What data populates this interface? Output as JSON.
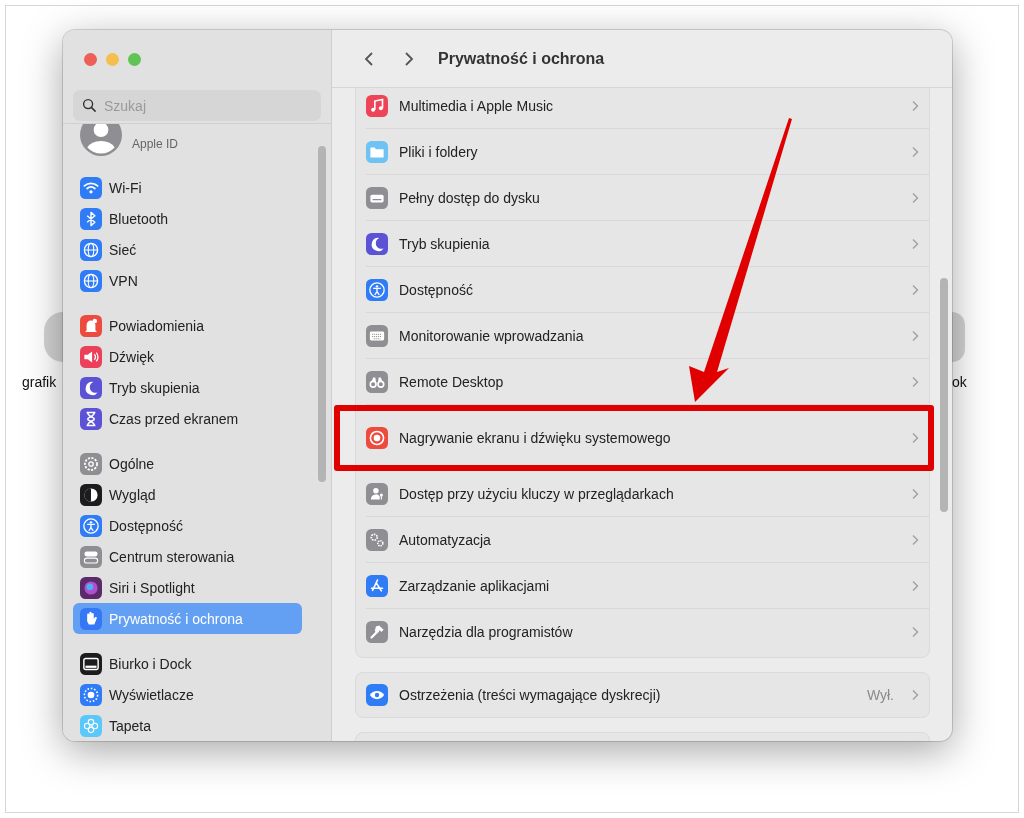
{
  "desktop_icons": [
    {
      "label": "grafik"
    },
    {
      "label": "ok"
    }
  ],
  "window": {
    "title": "Prywatność i ochrona"
  },
  "search": {
    "placeholder": "Szukaj"
  },
  "account": {
    "subtitle": "Apple ID"
  },
  "sidebar": {
    "groups": [
      {
        "items": [
          {
            "label": "Wi-Fi",
            "kind": "wifi",
            "color": "#2f7cf6",
            "selected": false
          },
          {
            "label": "Bluetooth",
            "kind": "bluetooth",
            "color": "#2f7cf6",
            "selected": false
          },
          {
            "label": "Sieć",
            "kind": "globe",
            "color": "#2f7cf6",
            "selected": false
          },
          {
            "label": "VPN",
            "kind": "globe",
            "color": "#2f7cf6",
            "selected": false
          }
        ]
      },
      {
        "items": [
          {
            "label": "Powiadomienia",
            "kind": "bell",
            "color": "#ee4b3f",
            "selected": false
          },
          {
            "label": "Dźwięk",
            "kind": "speaker",
            "color": "#ec3f5a",
            "selected": false
          },
          {
            "label": "Tryb skupienia",
            "kind": "moon",
            "color": "#5b52d6",
            "selected": false
          },
          {
            "label": "Czas przed ekranem",
            "kind": "hourglass",
            "color": "#5b52d6",
            "selected": false
          }
        ]
      },
      {
        "items": [
          {
            "label": "Ogólne",
            "kind": "gear",
            "color": "#8e8e93",
            "selected": false
          },
          {
            "label": "Wygląd",
            "kind": "contrast",
            "color": "#1c1c1e",
            "selected": false
          },
          {
            "label": "Dostępność",
            "kind": "accessibility",
            "color": "#2f7cf6",
            "selected": false
          },
          {
            "label": "Centrum sterowania",
            "kind": "toggle",
            "color": "#8e8e93",
            "selected": false
          },
          {
            "label": "Siri i Spotlight",
            "kind": "orb",
            "color": "#5a2a6a",
            "selected": false
          },
          {
            "label": "Prywatność i ochrona",
            "kind": "hand",
            "color": "#3478f6",
            "selected": true
          }
        ]
      },
      {
        "items": [
          {
            "label": "Biurko i Dock",
            "kind": "dock",
            "color": "#1c1c1e",
            "selected": false
          },
          {
            "label": "Wyświetlacze",
            "kind": "sun",
            "color": "#2f7cf6",
            "selected": false
          },
          {
            "label": "Tapeta",
            "kind": "flower",
            "color": "#5ac8fa",
            "selected": false
          }
        ]
      }
    ]
  },
  "privacy_items": [
    {
      "label": "Multimedia i Apple Music",
      "kind": "music",
      "color": "#ee4458",
      "highlighted": false
    },
    {
      "label": "Pliki i foldery",
      "kind": "folder",
      "color": "#6ec3f4",
      "highlighted": false
    },
    {
      "label": "Pełny dostęp do dysku",
      "kind": "disk",
      "color": "#8e8e93",
      "highlighted": false
    },
    {
      "label": "Tryb skupienia",
      "kind": "moon",
      "color": "#5b52d6",
      "highlighted": false
    },
    {
      "label": "Dostępność",
      "kind": "accessibility",
      "color": "#2f7cf6",
      "highlighted": false
    },
    {
      "label": "Monitorowanie wprowadzania",
      "kind": "keyboard",
      "color": "#8e8e93",
      "highlighted": false
    },
    {
      "label": "Remote Desktop",
      "kind": "binoculars",
      "color": "#8e8e93",
      "highlighted": false
    },
    {
      "label": "Nagrywanie ekranu i dźwięku systemowego",
      "kind": "record",
      "color": "#ee4b3f",
      "highlighted": true
    },
    {
      "label": "Dostęp przy użyciu kluczy w przeglądarkach",
      "kind": "person",
      "color": "#8e8e93",
      "highlighted": false
    },
    {
      "label": "Automatyzacja",
      "kind": "gears",
      "color": "#8e8e93",
      "highlighted": false
    },
    {
      "label": "Zarządzanie aplikacjami",
      "kind": "appstore",
      "color": "#2f7cf6",
      "highlighted": false
    },
    {
      "label": "Narzędzia dla programistów",
      "kind": "hammer",
      "color": "#8e8e93",
      "highlighted": false
    }
  ],
  "warning_row": {
    "label": "Ostrzeżenia (treści wymagające dyskrecji)",
    "value": "Wył.",
    "kind": "eye",
    "color": "#2f7cf6"
  }
}
